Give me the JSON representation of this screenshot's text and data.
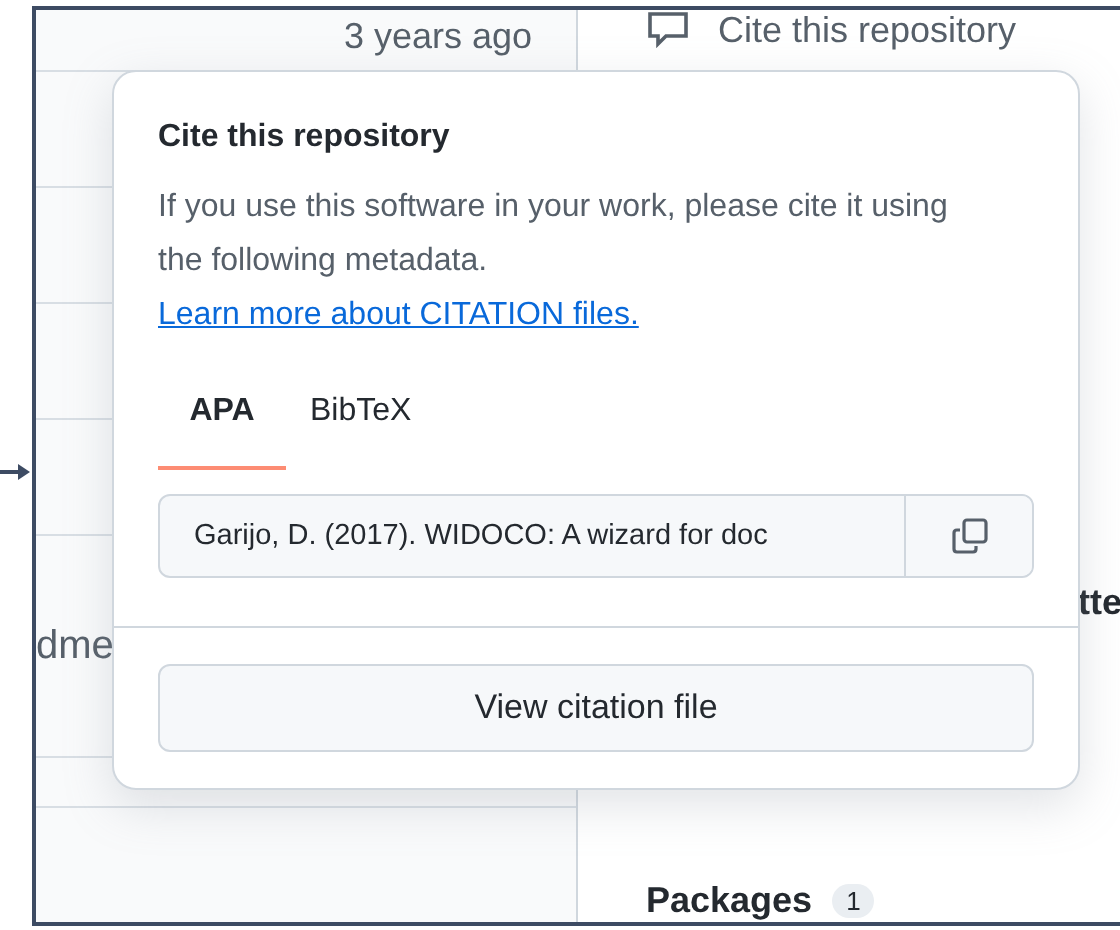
{
  "background": {
    "timestamp": "3 years ago",
    "cite_button": "Cite this repository",
    "left_fragment": "dme",
    "right_fragment": "tte",
    "packages": {
      "label": "Packages",
      "count": "1"
    }
  },
  "popover": {
    "title": "Cite this repository",
    "description": "If you use this software in your work, please cite it using the following metadata.",
    "link": "Learn more about CITATION files.",
    "tabs": [
      {
        "label": "APA",
        "selected": true
      },
      {
        "label": "BibTeX",
        "selected": false
      }
    ],
    "citation": "Garijo, D. (2017). WIDOCO: A wizard for doc",
    "action": "View citation file"
  }
}
